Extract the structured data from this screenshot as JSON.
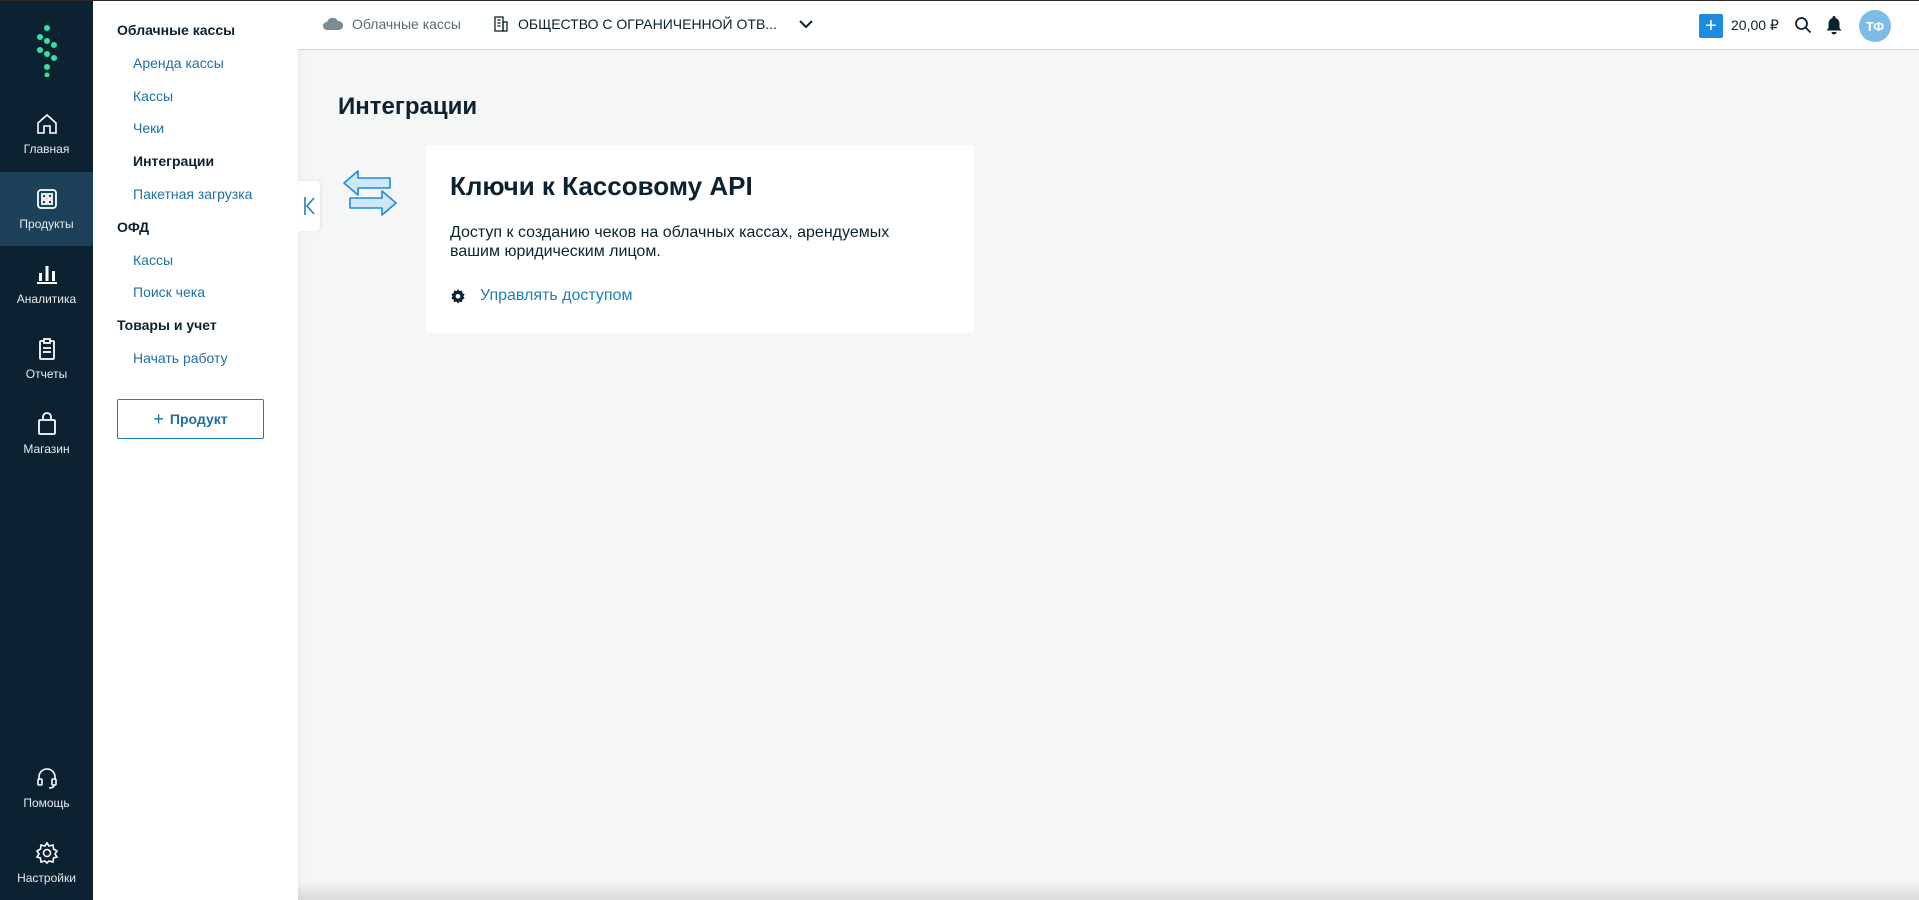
{
  "rail": {
    "items": [
      {
        "label": "Главная",
        "icon": "home-icon"
      },
      {
        "label": "Продукты",
        "icon": "grid-icon"
      },
      {
        "label": "Аналитика",
        "icon": "chart-icon"
      },
      {
        "label": "Отчеты",
        "icon": "clipboard-icon"
      },
      {
        "label": "Магазин",
        "icon": "bag-icon"
      }
    ],
    "bottom": [
      {
        "label": "Помощь",
        "icon": "headset-icon"
      },
      {
        "label": "Настройки",
        "icon": "gear-icon"
      }
    ]
  },
  "subnav": {
    "section1": "Облачные кассы",
    "section1_items": [
      "Аренда кассы",
      "Кассы",
      "Чеки",
      "Интеграции",
      "Пакетная загрузка"
    ],
    "section2": "ОФД",
    "section2_items": [
      "Кассы",
      "Поиск чека"
    ],
    "section3": "Товары и учет",
    "section3_items": [
      "Начать работу"
    ],
    "add_button": "Продукт",
    "add_plus": "+"
  },
  "topbar": {
    "product": "Облачные кассы",
    "organization": "ОБЩЕСТВО С ОГРАНИЧЕННОЙ ОТВ...",
    "plus": "+",
    "balance": "20,00 ₽",
    "avatar": "ТФ"
  },
  "main": {
    "title": "Интеграции",
    "card": {
      "title": "Ключи к Кассовому API",
      "description": "Доступ к созданию чеков на облачных кассах, арендуемых вашим юридическим лицом.",
      "link": "Управлять доступом"
    }
  },
  "colors": {
    "rail_bg": "#0c2231",
    "rail_active": "#1d4158",
    "accent": "#1d8ce0",
    "link": "#1d6fa5",
    "avatar": "#7bbde6"
  }
}
